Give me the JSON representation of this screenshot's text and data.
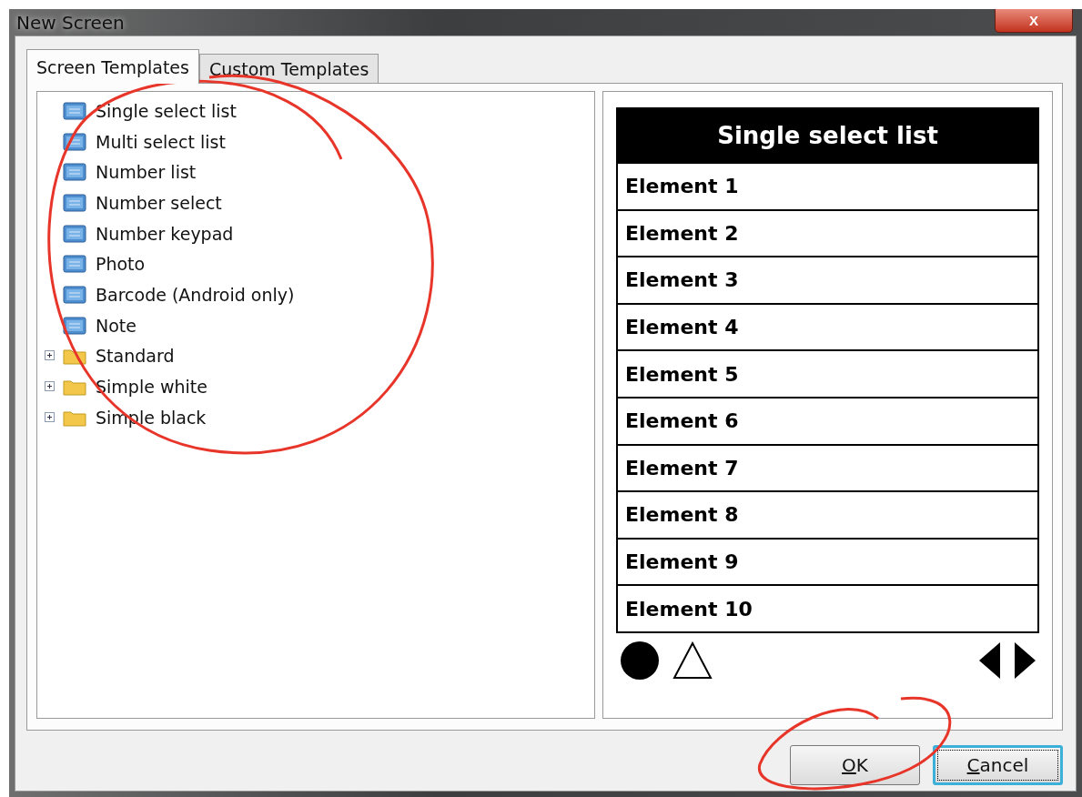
{
  "window": {
    "title": "New Screen",
    "close_label": "X"
  },
  "tabs": [
    {
      "label": "Screen Templates",
      "selected": true
    },
    {
      "label": "Custom Templates",
      "selected": false
    }
  ],
  "tree": {
    "items": [
      {
        "kind": "template",
        "label": "Single select list"
      },
      {
        "kind": "template",
        "label": "Multi select list"
      },
      {
        "kind": "template",
        "label": "Number list"
      },
      {
        "kind": "template",
        "label": "Number select"
      },
      {
        "kind": "template",
        "label": "Number keypad"
      },
      {
        "kind": "template",
        "label": "Photo"
      },
      {
        "kind": "template",
        "label": "Barcode (Android only)"
      },
      {
        "kind": "template",
        "label": "Note"
      },
      {
        "kind": "folder",
        "label": "Standard",
        "expanded": false
      },
      {
        "kind": "folder",
        "label": "Simple white",
        "expanded": false
      },
      {
        "kind": "folder",
        "label": "Simple black",
        "expanded": false
      }
    ]
  },
  "preview": {
    "title": "Single select list",
    "elements": [
      "Element 1",
      "Element 2",
      "Element 3",
      "Element 4",
      "Element 5",
      "Element 6",
      "Element 7",
      "Element 8",
      "Element 9",
      "Element 10"
    ]
  },
  "buttons": [
    {
      "label": "OK",
      "focused": false
    },
    {
      "label": "Cancel",
      "focused": true
    }
  ]
}
